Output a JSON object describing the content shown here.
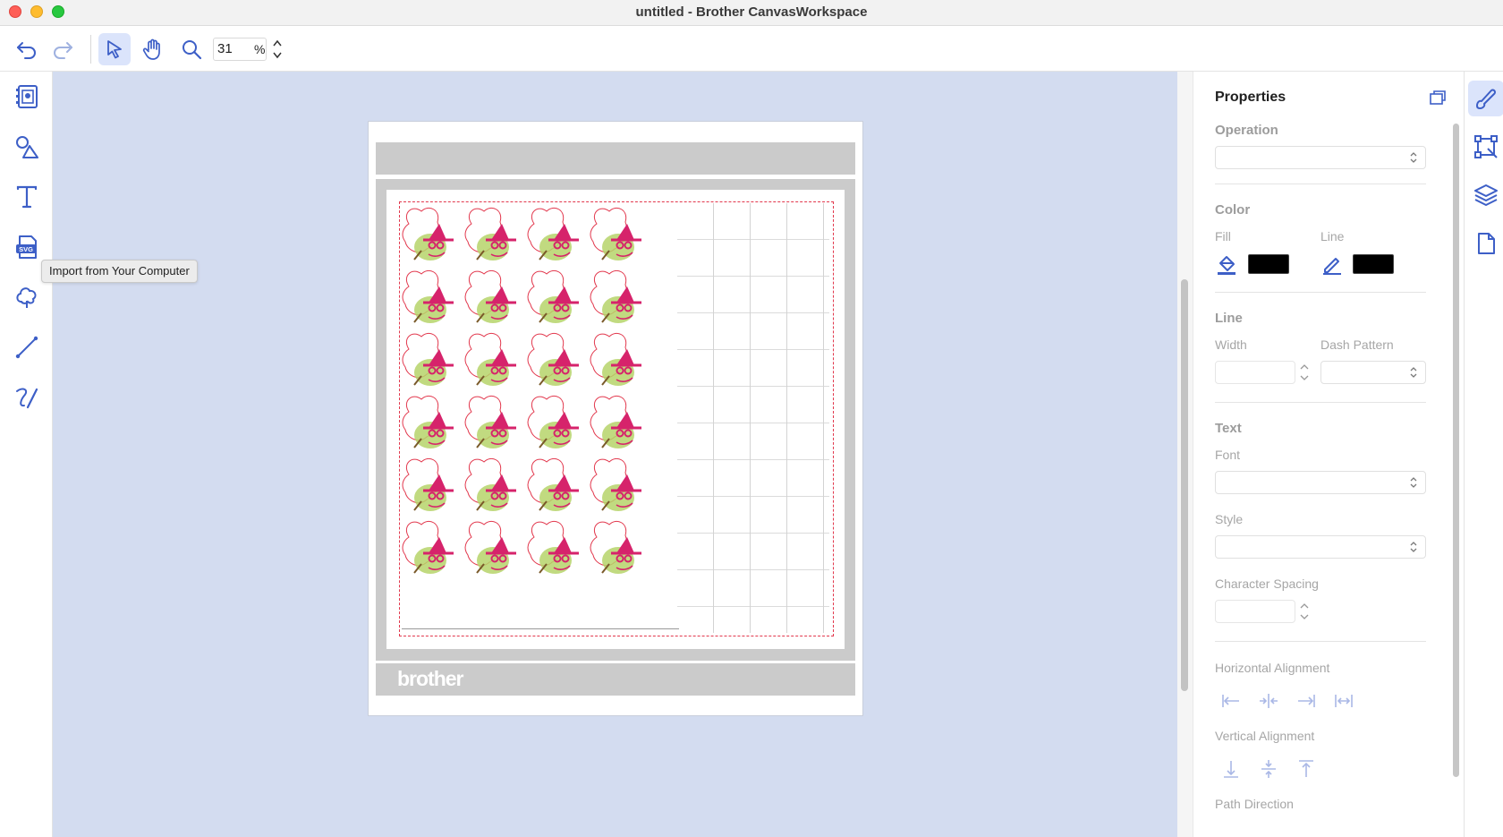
{
  "window": {
    "title": "untitled - Brother CanvasWorkspace"
  },
  "toolbar": {
    "undo_icon": "undo-icon",
    "redo_icon": "redo-icon",
    "select_icon": "pointer-icon",
    "pan_icon": "hand-icon",
    "zoom_icon": "magnifier-icon",
    "zoom_value": "31",
    "zoom_unit": "%"
  },
  "left_tools": [
    {
      "name": "templates-icon"
    },
    {
      "name": "shapes-icon"
    },
    {
      "name": "text-icon"
    },
    {
      "name": "svg-import-icon"
    },
    {
      "name": "pattern-icon"
    },
    {
      "name": "line-icon"
    },
    {
      "name": "freehand-icon"
    }
  ],
  "tooltip": {
    "text": "Import from Your Computer"
  },
  "mat": {
    "brand": "brother"
  },
  "properties": {
    "title": "Properties",
    "operation": {
      "label": "Operation",
      "value": ""
    },
    "color": {
      "label": "Color",
      "fill_label": "Fill",
      "line_label": "Line",
      "fill_color": "#000000",
      "line_color": "#000000"
    },
    "line": {
      "label": "Line",
      "width_label": "Width",
      "width_value": "",
      "dash_label": "Dash Pattern",
      "dash_value": ""
    },
    "text": {
      "label": "Text",
      "font_label": "Font",
      "font_value": "",
      "style_label": "Style",
      "style_value": "",
      "spacing_label": "Character Spacing",
      "spacing_value": ""
    },
    "horizontal_alignment_label": "Horizontal Alignment",
    "vertical_alignment_label": "Vertical Alignment",
    "path_direction_label": "Path Direction"
  },
  "right_tabs": [
    {
      "name": "paint-brush-icon",
      "active": true
    },
    {
      "name": "transform-icon",
      "active": false
    },
    {
      "name": "layers-icon",
      "active": false
    },
    {
      "name": "page-icon",
      "active": false
    }
  ],
  "colors": {
    "accent": "#3d5fc7",
    "canvas_bg": "#d3dcf0",
    "cut_line": "#e2384d",
    "motif_pink": "#d6236b",
    "motif_green": "#b6d36a"
  }
}
